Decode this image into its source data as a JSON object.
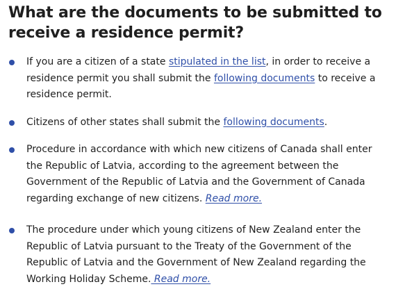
{
  "heading": "What are the documents to be submitted to receive a residence permit?",
  "items": [
    {
      "pre": "If you are a citizen of a state ",
      "link1": "stipulated in the list",
      "mid": ", in order to receive a residence permit you shall submit the ",
      "link2": "following documents",
      "post": " to receive a residence permit."
    },
    {
      "pre": "Citizens of other states shall submit the ",
      "link1": "following documents",
      "post": "."
    },
    {
      "text": "Procedure in accordance with which new citizens of Canada shall enter the Republic of Latvia, according to the agreement between the Government of the Republic of Latvia and the Government of Canada regarding exchange of new citizens. ",
      "read_more": "Read more."
    },
    {
      "text": "The procedure under which young citizens of New Zealand enter the Republic of Latvia pursuant to the Treaty of the Government of the Republic of Latvia and the Government of New Zealand regarding the Working Holiday Scheme.",
      "read_more": " Read more."
    }
  ],
  "colors": {
    "link": "#2f4fa8",
    "bullet": "#2f4fa8",
    "text": "#1f1f1f"
  }
}
